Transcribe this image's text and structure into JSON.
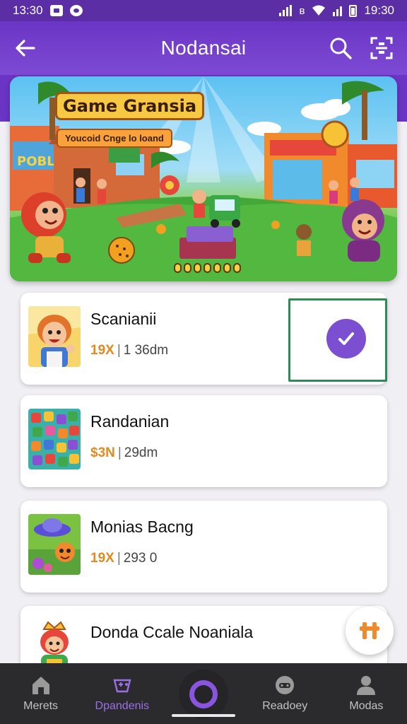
{
  "status_bar": {
    "time_left": "13:30",
    "time_right": "19:30"
  },
  "app_bar": {
    "title": "Nodansai"
  },
  "banner": {
    "title": "Game Gransia",
    "subtitle": "Youcoid Cnge lo loand"
  },
  "games": [
    {
      "name": "Scanianii",
      "price": "19X",
      "meta": "1 36dm",
      "icon": "cartoon-boy-icon",
      "selected": true
    },
    {
      "name": "Randanian",
      "price": "$3N",
      "meta": "29dm",
      "icon": "puzzle-blocks-icon",
      "selected": false
    },
    {
      "name": "Monias Bacng",
      "price": "19X",
      "meta": "293 0",
      "icon": "ufo-monster-icon",
      "selected": false
    },
    {
      "name": "Donda Ccale Noaniala",
      "price": "",
      "meta": "",
      "icon": "cartoon-king-icon",
      "selected": false
    }
  ],
  "bottom_nav": {
    "items": [
      {
        "label": "Merets",
        "icon": "home-icon"
      },
      {
        "label": "Dpandenis",
        "icon": "gamepad-icon"
      },
      {
        "label": "",
        "icon": "record-icon"
      },
      {
        "label": "Readoey",
        "icon": "controller-icon"
      },
      {
        "label": "Modas",
        "icon": "profile-icon"
      }
    ],
    "active_index": 1
  },
  "colors": {
    "primary": "#6a35c4",
    "accent": "#7c4fd0",
    "price": "#e28a1e",
    "selection_border": "#2e8a57"
  }
}
